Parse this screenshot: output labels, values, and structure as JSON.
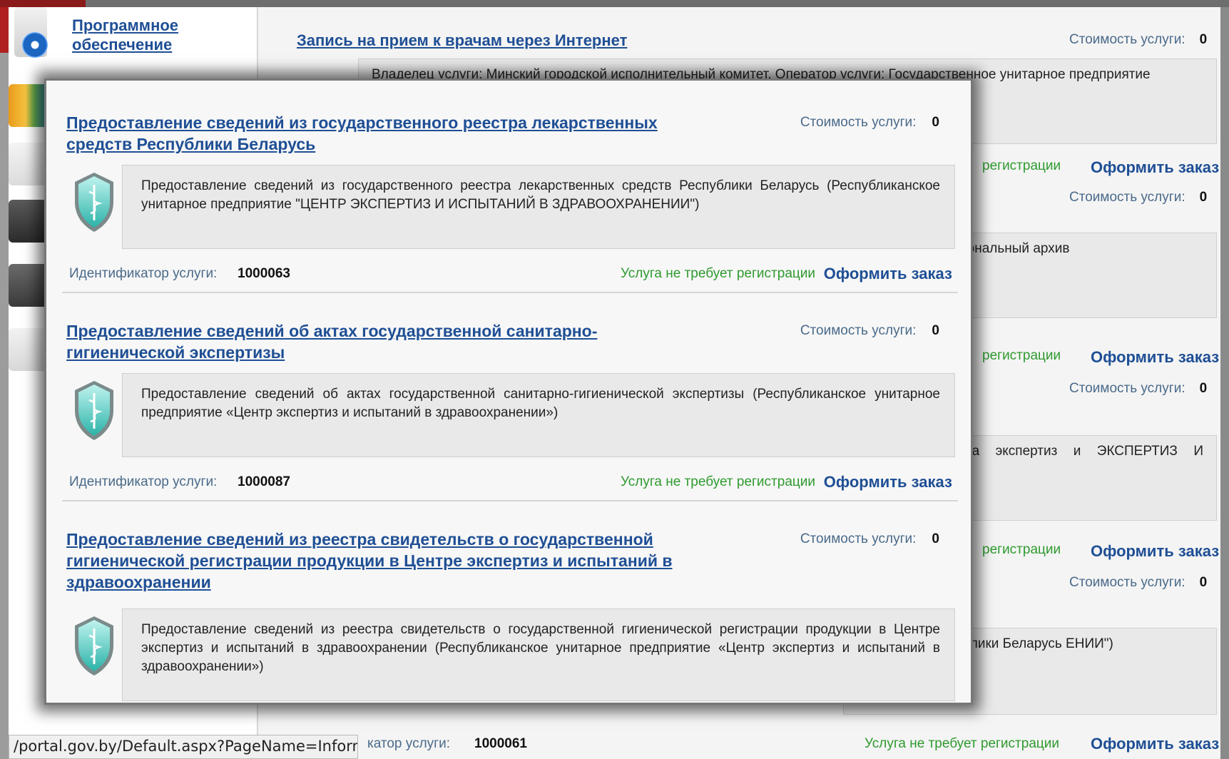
{
  "sidebar": {
    "items": [
      {
        "label": "Программное обеспечение",
        "icon": "software-disc-icon"
      }
    ]
  },
  "background": {
    "title": "Запись на прием к врачам через Интернет",
    "cost_label": "Стоимость услуги:",
    "cost_value": "0",
    "box1_text": "Владелец услуги: Минский городской исполнительный комитет. Оператор услуги: Государственное унитарное предприятие",
    "reg_partial": "регистрации",
    "order_label": "Оформить заказ",
    "box2_text": "чреждение \"Национальный архив",
    "box3_text": "ториями «Центра экспертиз и ЭКСПЕРТИЗ И ИСПЫТАНИЙ В",
    "box4_text": "азначения Республики Беларусь ЕНИИ\")",
    "id_label_partial": "катор услуги:",
    "id_value": "1000061",
    "reg_full": "Услуга не требует регистрации"
  },
  "popup": {
    "services": [
      {
        "title": "Предоставление сведений из государственного реестра лекарственных средств Республики Беларусь",
        "cost_label": "Стоимость услуги:",
        "cost_value": "0",
        "description": "Предоставление сведений из государственного реестра лекарственных средств Республики Беларусь (Республиканское унитарное предприятие \"ЦЕНТР ЭКСПЕРТИЗ И ИСПЫТАНИЙ В ЗДРАВООХРАНЕНИИ\")",
        "id_label": "Идентификатор услуги:",
        "id_value": "1000063",
        "registration": "Услуга не требует регистрации",
        "order": "Оформить заказ"
      },
      {
        "title": "Предоставление сведений об актах государственной санитарно-гигиенической экспертизы",
        "cost_label": "Стоимость услуги:",
        "cost_value": "0",
        "description": "Предоставление сведений об актах государственной санитарно-гигиенической экспертизы (Республиканское унитарное предприятие «Центр экспертиз и испытаний в здравоохранении»)",
        "id_label": "Идентификатор услуги:",
        "id_value": "1000087",
        "registration": "Услуга не требует регистрации",
        "order": "Оформить заказ"
      },
      {
        "title": "Предоставление сведений из реестра свидетельств о государственной гигиенической регистрации продукции в Центре экспертиз и испытаний в здравоохранении",
        "cost_label": "Стоимость услуги:",
        "cost_value": "0",
        "description": "Предоставление сведений из реестра свидетельств о государственной гигиенической регистрации продукции в Центре экспертиз и испытаний в здравоохранении (Республиканское унитарное предприятие «Центр экспертиз и испытаний в здравоохранении»)"
      }
    ]
  },
  "status_bar": {
    "url": "/portal.gov.by/Default.aspx?PageName=Information"
  },
  "colors": {
    "link": "#1f4f95",
    "registration": "#2f9a2f",
    "label": "#4a6a8a"
  }
}
